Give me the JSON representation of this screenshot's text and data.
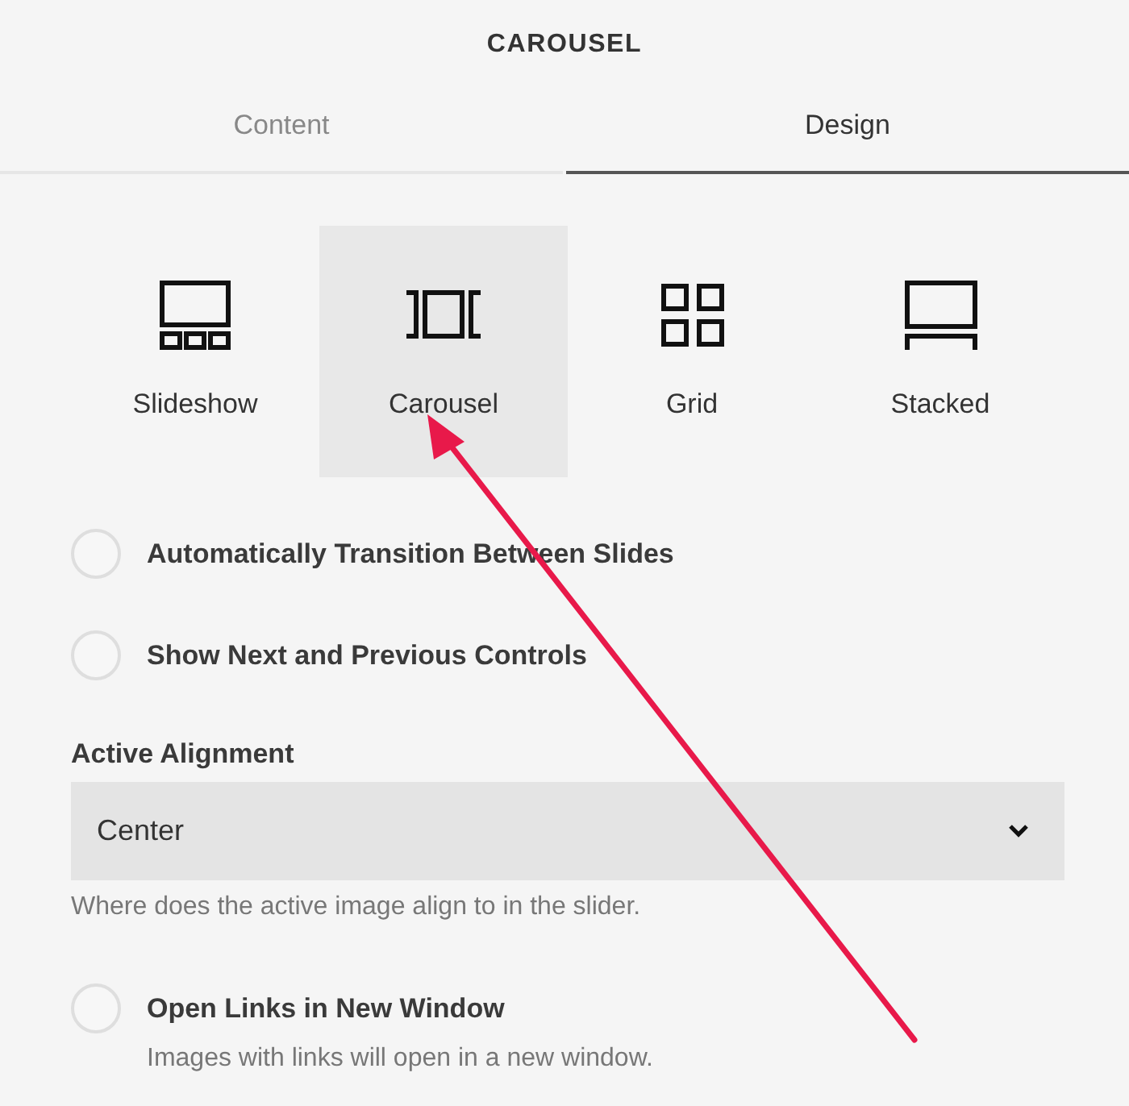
{
  "header": {
    "title": "CAROUSEL"
  },
  "tabs": [
    {
      "label": "Content",
      "selected": false
    },
    {
      "label": "Design",
      "selected": true
    }
  ],
  "layouts": [
    {
      "kind": "slideshow",
      "label": "Slideshow",
      "selected": false
    },
    {
      "kind": "carousel",
      "label": "Carousel",
      "selected": true
    },
    {
      "kind": "grid",
      "label": "Grid",
      "selected": false
    },
    {
      "kind": "stacked",
      "label": "Stacked",
      "selected": false
    }
  ],
  "options": [
    {
      "label": "Automatically Transition Between Slides",
      "on": false
    },
    {
      "label": "Show Next and Previous Controls",
      "on": false
    }
  ],
  "alignment": {
    "label": "Active Alignment",
    "value": "Center",
    "help": "Where does the active image align to in the slider."
  },
  "link_option": {
    "label": "Open Links in New Window",
    "on": false,
    "description": "Images with links will open in a new window."
  }
}
